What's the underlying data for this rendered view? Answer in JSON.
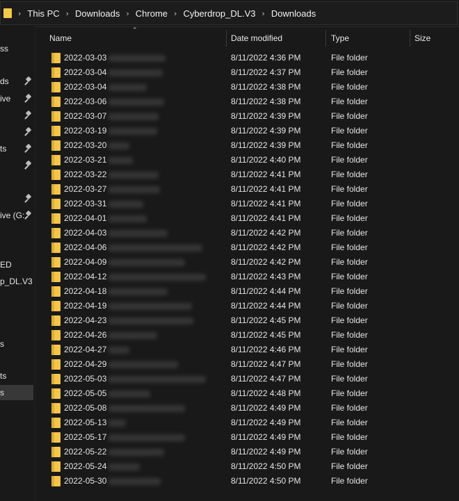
{
  "breadcrumb": [
    "This PC",
    "Downloads",
    "Chrome",
    "Cyberdrop_DL.V3",
    "Downloads"
  ],
  "icons": {
    "folder": "folder-icon",
    "pin": "pin-icon",
    "chevron": "chevron-right-icon",
    "sort": "sort-up-icon"
  },
  "colors": {
    "folder": "#f3c54d",
    "background": "#191919",
    "selected": "#383838"
  },
  "sidebar": {
    "items": [
      {
        "label": "ss",
        "pinned": false
      },
      {
        "label": "ds",
        "pinned": true
      },
      {
        "label": "ive",
        "pinned": true
      },
      {
        "label": "",
        "pinned": true
      },
      {
        "label": "",
        "pinned": true
      },
      {
        "label": "ts",
        "pinned": true
      },
      {
        "label": "",
        "pinned": true
      },
      {
        "label": "",
        "pinned": true
      },
      {
        "label": "",
        "pinned": true
      },
      {
        "label": "ive (G:",
        "pinned": true
      },
      {
        "label": "ED",
        "pinned": false
      },
      {
        "label": "p_DL.V3",
        "pinned": false
      },
      {
        "label": "s",
        "pinned": false
      },
      {
        "label": "ts",
        "pinned": false
      },
      {
        "label": "s",
        "pinned": false,
        "selected": true
      }
    ]
  },
  "columns": {
    "name": "Name",
    "date": "Date modified",
    "type": "Type",
    "size": "Size"
  },
  "files": [
    {
      "name": "2022-03-03",
      "date": "8/11/2022 4:36 PM",
      "type": "File folder"
    },
    {
      "name": "2022-03-04",
      "date": "8/11/2022 4:37 PM",
      "type": "File folder"
    },
    {
      "name": "2022-03-04",
      "date": "8/11/2022 4:38 PM",
      "type": "File folder"
    },
    {
      "name": "2022-03-06",
      "date": "8/11/2022 4:38 PM",
      "type": "File folder"
    },
    {
      "name": "2022-03-07",
      "date": "8/11/2022 4:39 PM",
      "type": "File folder"
    },
    {
      "name": "2022-03-19",
      "date": "8/11/2022 4:39 PM",
      "type": "File folder"
    },
    {
      "name": "2022-03-20",
      "date": "8/11/2022 4:39 PM",
      "type": "File folder"
    },
    {
      "name": "2022-03-21",
      "date": "8/11/2022 4:40 PM",
      "type": "File folder"
    },
    {
      "name": "2022-03-22",
      "date": "8/11/2022 4:41 PM",
      "type": "File folder"
    },
    {
      "name": "2022-03-27",
      "date": "8/11/2022 4:41 PM",
      "type": "File folder"
    },
    {
      "name": "2022-03-31",
      "date": "8/11/2022 4:41 PM",
      "type": "File folder"
    },
    {
      "name": "2022-04-01",
      "date": "8/11/2022 4:41 PM",
      "type": "File folder"
    },
    {
      "name": "2022-04-03",
      "date": "8/11/2022 4:42 PM",
      "type": "File folder"
    },
    {
      "name": "2022-04-06",
      "date": "8/11/2022 4:42 PM",
      "type": "File folder"
    },
    {
      "name": "2022-04-09",
      "date": "8/11/2022 4:42 PM",
      "type": "File folder"
    },
    {
      "name": "2022-04-12",
      "date": "8/11/2022 4:43 PM",
      "type": "File folder"
    },
    {
      "name": "2022-04-18",
      "date": "8/11/2022 4:44 PM",
      "type": "File folder"
    },
    {
      "name": "2022-04-19",
      "date": "8/11/2022 4:44 PM",
      "type": "File folder"
    },
    {
      "name": "2022-04-23",
      "date": "8/11/2022 4:45 PM",
      "type": "File folder"
    },
    {
      "name": "2022-04-26",
      "date": "8/11/2022 4:45 PM",
      "type": "File folder"
    },
    {
      "name": "2022-04-27",
      "date": "8/11/2022 4:46 PM",
      "type": "File folder"
    },
    {
      "name": "2022-04-29",
      "date": "8/11/2022 4:47 PM",
      "type": "File folder"
    },
    {
      "name": "2022-05-03",
      "date": "8/11/2022 4:47 PM",
      "type": "File folder"
    },
    {
      "name": "2022-05-05",
      "date": "8/11/2022 4:48 PM",
      "type": "File folder"
    },
    {
      "name": "2022-05-08",
      "date": "8/11/2022 4:49 PM",
      "type": "File folder"
    },
    {
      "name": "2022-05-13",
      "date": "8/11/2022 4:49 PM",
      "type": "File folder"
    },
    {
      "name": "2022-05-17",
      "date": "8/11/2022 4:49 PM",
      "type": "File folder"
    },
    {
      "name": "2022-05-22",
      "date": "8/11/2022 4:49 PM",
      "type": "File folder"
    },
    {
      "name": "2022-05-24",
      "date": "8/11/2022 4:50 PM",
      "type": "File folder"
    },
    {
      "name": "2022-05-30",
      "date": "8/11/2022 4:50 PM",
      "type": "File folder"
    }
  ]
}
